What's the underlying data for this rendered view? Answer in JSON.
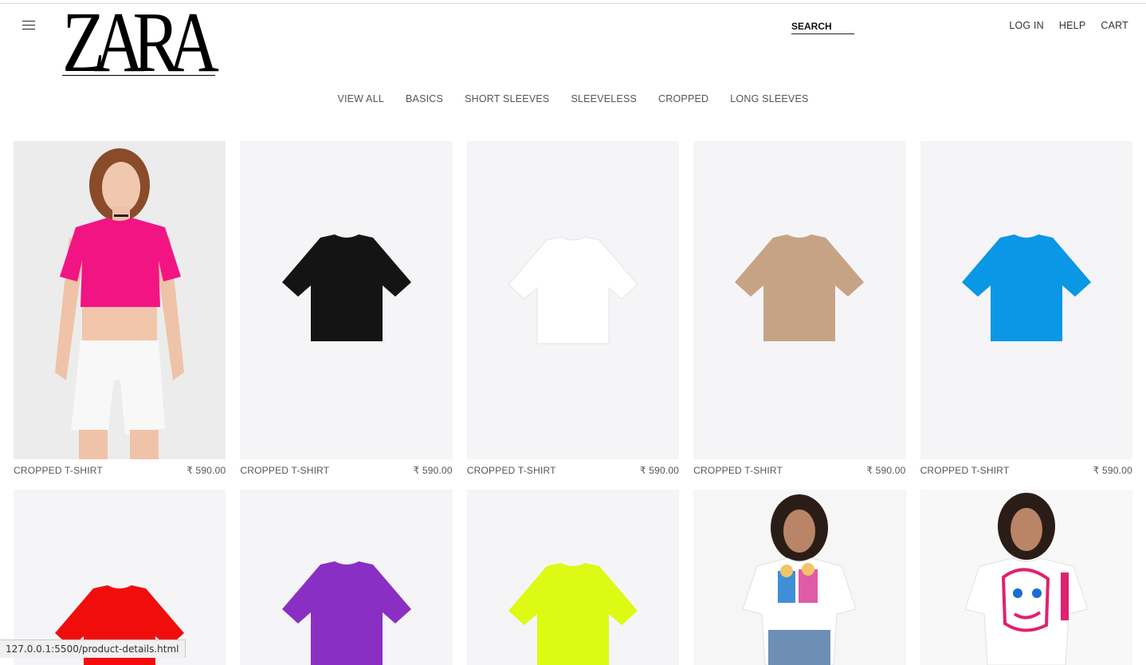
{
  "header": {
    "logo_text": "ZARA",
    "search_label": "SEARCH",
    "links": [
      "LOG IN",
      "HELP",
      "CART"
    ]
  },
  "categories": [
    "VIEW ALL",
    "BASICS",
    "SHORT SLEEVES",
    "SLEEVELESS",
    "CROPPED",
    "LONG SLEEVES"
  ],
  "products": [
    {
      "name": "CROPPED T-SHIRT",
      "price": "₹ 590.00",
      "color": "#f21483",
      "kind": "model"
    },
    {
      "name": "CROPPED T-SHIRT",
      "price": "₹ 590.00",
      "color": "#141414",
      "kind": "tee"
    },
    {
      "name": "CROPPED T-SHIRT",
      "price": "₹ 590.00",
      "color": "#ffffff",
      "kind": "tee"
    },
    {
      "name": "CROPPED T-SHIRT",
      "price": "₹ 590.00",
      "color": "#c7a385",
      "kind": "tee"
    },
    {
      "name": "CROPPED T-SHIRT",
      "price": "₹ 590.00",
      "color": "#0a97e6",
      "kind": "tee"
    }
  ],
  "products_row2": [
    {
      "color": "#f20d0d",
      "kind": "tee"
    },
    {
      "color": "#8a2fc4",
      "kind": "tee"
    },
    {
      "color": "#dcfa14",
      "kind": "tee"
    },
    {
      "color": "#ffffff",
      "kind": "model-print"
    },
    {
      "color": "#ffffff",
      "kind": "model-print"
    }
  ],
  "status_url": "127.0.0.1:5500/product-details.html"
}
